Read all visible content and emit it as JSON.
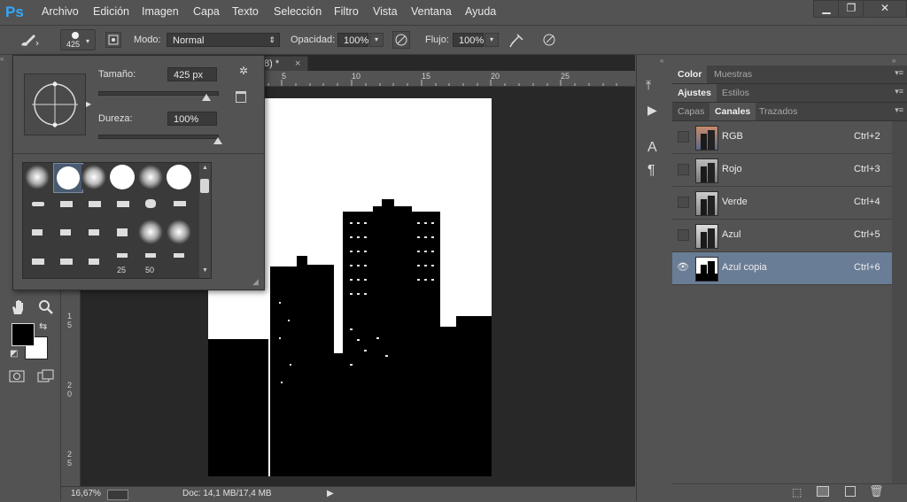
{
  "app": {
    "logo": "Ps"
  },
  "menu": [
    "Archivo",
    "Edición",
    "Imagen",
    "Capa",
    "Texto",
    "Selección",
    "Filtro",
    "Vista",
    "Ventana",
    "Ayuda"
  ],
  "window_controls": {
    "minimize": "▁",
    "restore": "❐",
    "close": "✕"
  },
  "options_bar": {
    "brush_size": "425",
    "mode_label": "Modo:",
    "mode_value": "Normal",
    "opacity_label": "Opacidad:",
    "opacity_value": "100%",
    "flow_label": "Flujo:",
    "flow_value": "100%"
  },
  "brush_popup": {
    "size_label": "Tamaño:",
    "size_value": "425 px",
    "hardness_label": "Dureza:",
    "hardness_value": "100%",
    "size_slider_level": 0.9,
    "hardness_slider_level": 1.0,
    "preset_labels": [
      "25",
      "50"
    ]
  },
  "document": {
    "tab_suffix": "/8) *",
    "tab_close": "×",
    "ruler_top": [
      "5",
      "10",
      "15",
      "20",
      "25"
    ],
    "ruler_left": [
      "1\n5",
      "2\n0",
      "2\n5"
    ]
  },
  "status": {
    "zoom": "16,67%",
    "doc_info": "Doc: 14,1 MB/17,4 MB"
  },
  "panels": {
    "row1_tabs": [
      "Color",
      "Muestras"
    ],
    "row2_tabs": [
      "Ajustes",
      "Estilos"
    ],
    "row3_tabs": [
      "Capas",
      "Canales",
      "Trazados"
    ],
    "channels": [
      {
        "name": "RGB",
        "shortcut": "Ctrl+2",
        "selected": false
      },
      {
        "name": "Rojo",
        "shortcut": "Ctrl+3",
        "selected": false
      },
      {
        "name": "Verde",
        "shortcut": "Ctrl+4",
        "selected": false
      },
      {
        "name": "Azul",
        "shortcut": "Ctrl+5",
        "selected": false
      },
      {
        "name": "Azul copia",
        "shortcut": "Ctrl+6",
        "selected": true
      }
    ]
  },
  "colors": {
    "panel_bg": "#535353",
    "canvas_bg": "#282828",
    "selection": "#6a7d96",
    "logo": "#31a8ff"
  }
}
